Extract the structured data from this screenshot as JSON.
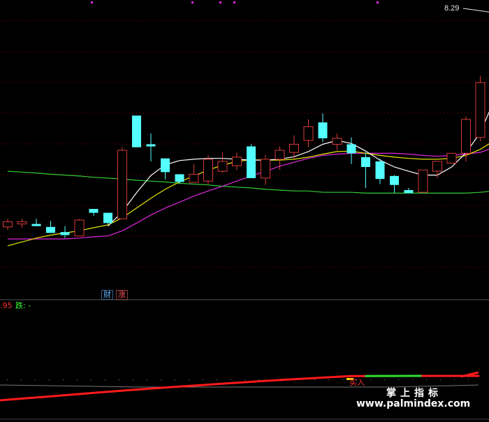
{
  "chart_data": {
    "type": "candlestick",
    "candles": [
      {
        "o": 0.0,
        "h": 0.19,
        "l": -0.07,
        "c": 0.12
      },
      {
        "o": 0.07,
        "h": 0.19,
        "l": -0.02,
        "c": 0.12
      },
      {
        "o": 0.07,
        "h": 0.19,
        "l": 0.02,
        "c": 0.02
      },
      {
        "o": 0.0,
        "h": 0.14,
        "l": -0.14,
        "c": -0.14
      },
      {
        "o": -0.12,
        "h": 0.02,
        "l": -0.26,
        "c": -0.19
      },
      {
        "o": -0.21,
        "h": 0.19,
        "l": -0.21,
        "c": 0.16
      },
      {
        "o": 0.42,
        "h": 0.42,
        "l": 0.26,
        "c": 0.33
      },
      {
        "o": 0.33,
        "h": 0.33,
        "l": 0.07,
        "c": 0.09
      },
      {
        "o": 0.19,
        "h": 1.86,
        "l": 0.19,
        "c": 1.79
      },
      {
        "o": 2.6,
        "h": 2.6,
        "l": 1.86,
        "c": 1.86
      },
      {
        "o": 1.93,
        "h": 2.18,
        "l": 1.53,
        "c": 1.88
      },
      {
        "o": 1.6,
        "h": 1.6,
        "l": 1.11,
        "c": 1.28
      },
      {
        "o": 1.23,
        "h": 1.23,
        "l": 1.0,
        "c": 1.05
      },
      {
        "o": 1.04,
        "h": 1.47,
        "l": 1.04,
        "c": 1.23
      },
      {
        "o": 1.07,
        "h": 1.68,
        "l": 1.0,
        "c": 1.58
      },
      {
        "o": 1.3,
        "h": 1.74,
        "l": 1.26,
        "c": 1.53
      },
      {
        "o": 1.43,
        "h": 1.74,
        "l": 1.33,
        "c": 1.63
      },
      {
        "o": 1.88,
        "h": 1.93,
        "l": 1.14,
        "c": 1.14
      },
      {
        "o": 1.14,
        "h": 1.68,
        "l": 0.98,
        "c": 1.58
      },
      {
        "o": 1.58,
        "h": 1.88,
        "l": 1.33,
        "c": 1.79
      },
      {
        "o": 1.74,
        "h": 2.14,
        "l": 1.6,
        "c": 1.93
      },
      {
        "o": 2.02,
        "h": 2.51,
        "l": 1.86,
        "c": 2.34
      },
      {
        "o": 2.44,
        "h": 2.65,
        "l": 1.98,
        "c": 2.07
      },
      {
        "o": 1.93,
        "h": 2.18,
        "l": 1.79,
        "c": 2.07
      },
      {
        "o": 1.93,
        "h": 2.09,
        "l": 1.47,
        "c": 1.72
      },
      {
        "o": 1.63,
        "h": 1.74,
        "l": 0.91,
        "c": 1.4
      },
      {
        "o": 1.53,
        "h": 1.6,
        "l": 1.0,
        "c": 1.12
      },
      {
        "o": 1.19,
        "h": 1.21,
        "l": 0.79,
        "c": 0.98
      },
      {
        "o": 0.86,
        "h": 0.91,
        "l": 0.79,
        "c": 0.79
      },
      {
        "o": 0.81,
        "h": 1.21,
        "l": 0.81,
        "c": 1.33
      },
      {
        "o": 1.3,
        "h": 1.53,
        "l": 1.14,
        "c": 1.53
      },
      {
        "o": 1.49,
        "h": 1.72,
        "l": 1.49,
        "c": 1.72
      },
      {
        "o": 1.72,
        "h": 2.58,
        "l": 1.53,
        "c": 2.51
      },
      {
        "o": 2.09,
        "h": 3.53,
        "l": 2.0,
        "c": 3.37
      },
      {
        "o": 3.98,
        "h": 5.02,
        "l": 3.86,
        "c": 5.02
      }
    ],
    "ma_white": [
      null,
      null,
      null,
      null,
      null,
      null,
      null,
      0.02,
      0.35,
      0.8,
      1.2,
      1.45,
      1.55,
      1.58,
      1.6,
      1.6,
      1.58,
      1.56,
      1.56,
      1.58,
      1.64,
      1.76,
      1.93,
      2.02,
      1.95,
      1.77,
      1.56,
      1.4,
      1.3,
      1.21,
      1.21,
      1.4,
      1.73,
      2.2,
      2.98
    ],
    "ma_yellow": [
      -0.44,
      -0.35,
      -0.26,
      -0.19,
      -0.14,
      -0.09,
      -0.02,
      0.05,
      0.21,
      0.44,
      0.67,
      0.88,
      1.05,
      1.19,
      1.33,
      1.44,
      1.53,
      1.57,
      1.56,
      1.56,
      1.58,
      1.63,
      1.7,
      1.76,
      1.77,
      1.72,
      1.67,
      1.63,
      1.6,
      1.58,
      1.58,
      1.6,
      1.67,
      1.81,
      2.02
    ],
    "ma_magenta": [
      -0.28,
      -0.28,
      -0.28,
      -0.28,
      -0.28,
      -0.26,
      -0.23,
      -0.21,
      -0.09,
      0.09,
      0.28,
      0.44,
      0.58,
      0.72,
      0.84,
      0.95,
      1.07,
      1.19,
      1.3,
      1.42,
      1.51,
      1.6,
      1.67,
      1.7,
      1.72,
      1.72,
      1.72,
      1.72,
      1.7,
      1.67,
      1.65,
      1.67,
      1.7,
      1.74,
      1.86
    ],
    "ma_green": [
      1.28,
      1.26,
      1.23,
      1.21,
      1.19,
      1.16,
      1.14,
      1.12,
      1.09,
      1.07,
      1.05,
      1.02,
      1.0,
      0.98,
      0.95,
      0.93,
      0.91,
      0.88,
      0.86,
      0.84,
      0.84,
      0.81,
      0.81,
      0.81,
      0.79,
      0.79,
      0.79,
      0.79,
      0.79,
      0.79,
      0.79,
      0.79,
      0.81,
      0.84,
      0.91
    ],
    "last_price": "8.29",
    "badges": [
      "财",
      "涨"
    ],
    "indicator": {
      "value_label": ".95",
      "down_label": "跌: -",
      "buy_label": "买入",
      "line": [
        0.0,
        0.06,
        0.12,
        0.18,
        0.24,
        0.3,
        0.36,
        0.42,
        0.48,
        0.54,
        0.58,
        0.63,
        0.67,
        0.71,
        0.74,
        0.78,
        0.81,
        0.84,
        0.87,
        0.9,
        0.92,
        0.94,
        0.95,
        0.96,
        0.97,
        0.98,
        0.98,
        0.99,
        0.99,
        1.0,
        1.0,
        1.0,
        1.0,
        1.0,
        1.0
      ],
      "line_colors": [
        "#ff1a1a",
        "#ff1a1a",
        "#ff1a1a",
        "#ff1a1a",
        "#ff1a1a",
        "#ff1a1a",
        "#ff1a1a",
        "#ff1a1a",
        "#ff1a1a",
        "#ff1a1a",
        "#ff1a1a",
        "#ff1a1a",
        "#ff1a1a",
        "#ff1a1a",
        "#ff1a1a",
        "#ff1a1a",
        "#ff1a1a",
        "#ff1a1a",
        "#ff1a1a",
        "#ff1a1a",
        "#ff1a1a",
        "#ff1a1a",
        "#ff1a1a",
        "#ff1a1a",
        "#ff1a1a",
        "#ff1a1a",
        "#33dd33",
        "#33dd33",
        "#33dd33",
        "#33dd33",
        "#ff1a1a",
        "#ff1a1a",
        "#ff1a1a",
        "#ff1a1a",
        "#ff1a1a"
      ]
    }
  },
  "watermark": {
    "title": "掌上指标",
    "url": "www.palmindex.com"
  },
  "colors": {
    "up": "#d83a3a",
    "down": "#54ffff",
    "ma_white": "#ffffff",
    "ma_yellow": "#e6e600",
    "ma_magenta": "#e028e0",
    "ma_green": "#33cc33",
    "grid": "#8b0000"
  }
}
